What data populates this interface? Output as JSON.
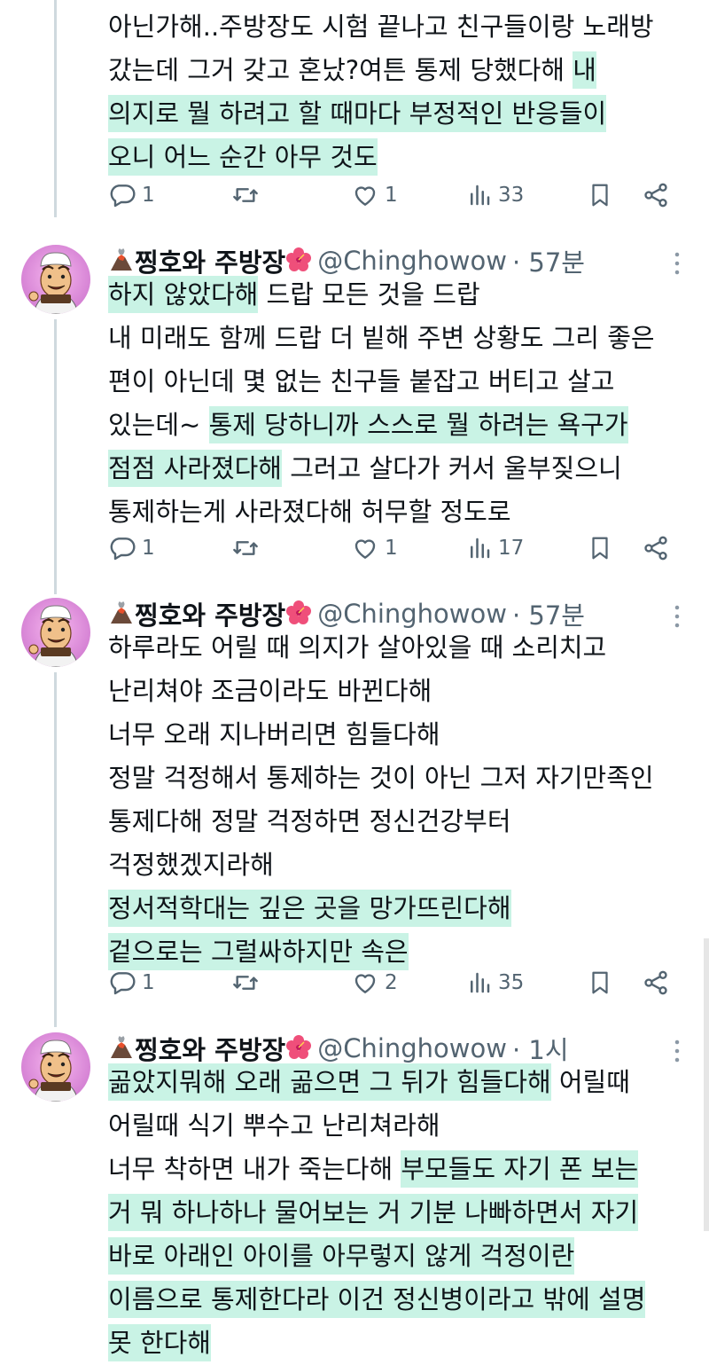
{
  "threads": [
    {
      "text_lines": [
        [
          {
            "t": "아닌가해..주방장도 시험 끝나고 친구들이랑 노래방",
            "h": false
          }
        ],
        [
          {
            "t": "갔는데 그거 갖고 혼났?여튼 통제 당했다해 ",
            "h": false
          },
          {
            "t": "내",
            "h": true
          }
        ],
        [
          {
            "t": "의지로 뭘 하려고 할 때마다 부정적인 반응들이",
            "h": true
          }
        ],
        [
          {
            "t": "오니 어느 순간 아무 것도",
            "h": true
          }
        ]
      ],
      "replies": "1",
      "retweets": "",
      "likes": "1",
      "views": "33"
    },
    {
      "name": "찡호와 주방장",
      "handle": "@Chinghowow",
      "time": "· 57분",
      "text_lines": [
        [
          {
            "t": "하지 않았다해",
            "h": true
          },
          {
            "t": " 드랍 모든 것을 드랍",
            "h": false
          }
        ],
        [
          {
            "t": "내 미래도 함께 드랍 더 빝해 주변 상황도 그리 좋은",
            "h": false
          }
        ],
        [
          {
            "t": "편이 아닌데 몇 없는 친구들 붙잡고 버티고 살고",
            "h": false
          }
        ],
        [
          {
            "t": "있는데~ ",
            "h": false
          },
          {
            "t": "통제 당하니까 스스로 뭘 하려는 욕구가",
            "h": true
          }
        ],
        [
          {
            "t": "점점 사라졌다해",
            "h": true
          },
          {
            "t": " 그러고 살다가 커서 울부짖으니",
            "h": false
          }
        ],
        [
          {
            "t": "통제하는게 사라졌다해 허무할 정도로",
            "h": false
          }
        ]
      ],
      "replies": "1",
      "retweets": "",
      "likes": "1",
      "views": "17"
    },
    {
      "name": "찡호와 주방장",
      "handle": "@Chinghowow",
      "time": "· 57분",
      "text_lines": [
        [
          {
            "t": "하루라도 어릴 때 의지가 살아있을 때 소리치고",
            "h": false
          }
        ],
        [
          {
            "t": "난리쳐야 조금이라도 바뀐다해",
            "h": false
          }
        ],
        [
          {
            "t": "너무 오래 지나버리면 힘들다해",
            "h": false
          }
        ],
        [
          {
            "t": "정말 걱정해서 통제하는 것이 아닌 그저 자기만족인",
            "h": false
          }
        ],
        [
          {
            "t": "통제다해 정말 걱정하면 정신건강부터",
            "h": false
          }
        ],
        [
          {
            "t": "걱정했겠지라해",
            "h": false
          }
        ],
        [
          {
            "t": "정서적학대는 깊은 곳을 망가뜨린다해",
            "h": true
          }
        ],
        [
          {
            "t": "겉으로는 그럴싸하지만 속은",
            "h": true
          }
        ]
      ],
      "replies": "1",
      "retweets": "",
      "likes": "2",
      "views": "35"
    },
    {
      "name": "찡호와 주방장",
      "handle": "@Chinghowow",
      "time": "· 1시",
      "text_lines": [
        [
          {
            "t": "곪았지뭐해 오래 곪으면 그 뒤가 힘들다해",
            "h": true
          },
          {
            "t": " 어릴때",
            "h": false
          }
        ],
        [
          {
            "t": "어릴때 식기 뿌수고 난리쳐라해",
            "h": false
          }
        ],
        [
          {
            "t": "너무 착하면 내가 죽는다해 ",
            "h": false
          },
          {
            "t": "부모들도 자기 폰 보는",
            "h": true
          }
        ],
        [
          {
            "t": "거 뭐 하나하나 물어보는 거 기분 나빠하면서 자기",
            "h": true
          }
        ],
        [
          {
            "t": "바로 아래인 아이를 아무렇지 않게 걱정이란",
            "h": true
          }
        ],
        [
          {
            "t": "이름으로 통제한다라 이건 정신병이라고 밖에 설명",
            "h": true
          }
        ],
        [
          {
            "t": "못 한다해",
            "h": true
          }
        ]
      ]
    }
  ],
  "icons": {
    "reply": "reply-icon",
    "retweet": "retweet-icon",
    "like": "heart-icon",
    "views": "views-icon",
    "bookmark": "bookmark-icon",
    "share": "share-icon",
    "more": "more-icon"
  },
  "colors": {
    "highlight": "#c9f3e5",
    "muted": "#536471",
    "text": "#0f1419",
    "thread_line": "#cfd9de"
  }
}
